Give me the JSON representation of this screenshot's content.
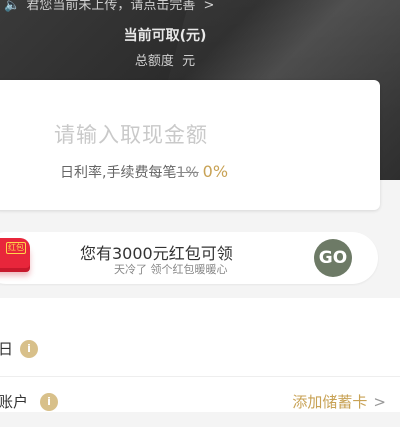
{
  "header": {
    "notice_icon": "speaker-icon",
    "notice_text": "君您当前未上传，请点击完善",
    "notice_arrow": ">",
    "available_title": "当前可取(元)",
    "credit_label": "总额度",
    "credit_unit": "元"
  },
  "amount": {
    "placeholder": "请输入取现金额",
    "rate_prefix": "日利率,手续费每笔",
    "fee_old": "1%",
    "fee_new": "0%"
  },
  "promo": {
    "badge_text": "红包",
    "title": "您有3000元红包可领",
    "subtitle": "天冷了 领个红包暖暖心",
    "go_label": "GO"
  },
  "rows": [
    {
      "label": "日",
      "icon": "info-icon",
      "icon_glyph": "i"
    },
    {
      "label": "账户",
      "icon": "info-icon",
      "icon_glyph": "i",
      "action": "添加储蓄卡",
      "chevron": ">"
    }
  ],
  "colors": {
    "accent_gold": "#c8a255",
    "header_dark": "#2b2b2b",
    "go_button": "#6d7a66",
    "badge_red": "#e8263b"
  }
}
